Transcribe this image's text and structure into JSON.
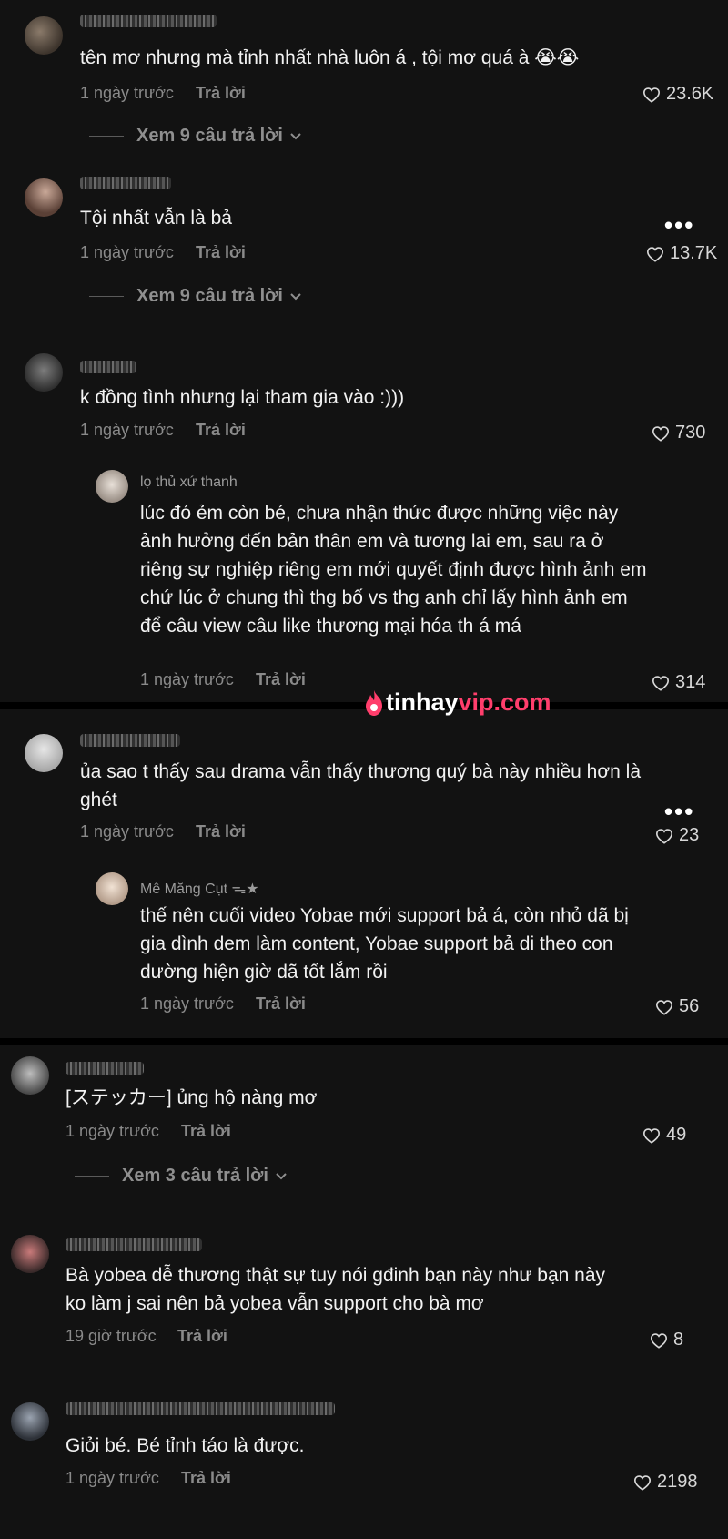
{
  "comments": [
    {
      "text": "tên mơ nhưng mà tỉnh nhất nhà luôn á , tội mơ quá à 😭😭",
      "time": "1 ngày trước",
      "reply": "Trả lời",
      "likes": "23.6K",
      "view_replies": "Xem 9 câu trả lời"
    },
    {
      "text": "Tội nhất vẫn là bả",
      "time": "1 ngày trước",
      "reply": "Trả lời",
      "likes": "13.7K",
      "more": "•••",
      "view_replies": "Xem 9 câu trả lời"
    },
    {
      "text": "k đồng tình nhưng lại tham gia vào :)))",
      "time": "1 ngày trước",
      "reply": "Trả lời",
      "likes": "730",
      "sub": {
        "username": "lọ thủ xứ thanh",
        "text": "lúc đó ẻm còn bé, chưa nhận thức được những việc này ảnh hưởng đến bản thân em và tương lai em, sau ra ở riêng sự nghiệp riêng em mới quyết định được hình ảnh em chứ lúc ở chung thì thg bố vs thg anh chỉ lấy hình ảnh em để câu view câu like thương mại hóa th á má",
        "time": "1 ngày trước",
        "reply": "Trả lời",
        "likes": "314"
      }
    },
    {
      "text": "ủa sao t thấy sau drama vẫn thấy thương quý bà này nhiều hơn là ghét",
      "time": "1 ngày trước",
      "reply": "Trả lời",
      "likes": "23",
      "more": "•••",
      "sub": {
        "username": "Mê Măng Cụt ᯓ★",
        "text": "thế nên cuối video Yobae mới support bả á, còn nhỏ dã bị gia dình dem làm content, Yobae support bả di theo con dường hiện giờ dã tốt lắm rồi",
        "time": "1 ngày trước",
        "reply": "Trả lời",
        "likes": "56"
      }
    },
    {
      "text": "[ステッカー] ủng hộ nàng mơ",
      "time": "1 ngày trước",
      "reply": "Trả lời",
      "likes": "49",
      "view_replies": "Xem 3 câu trả lời"
    },
    {
      "text": "Bà yobea dễ thương thật sự tuy nói gđinh bạn này như bạn này ko làm j sai nên bả yobea vẫn support cho bà mơ",
      "time": "19 giờ trước",
      "reply": "Trả lời",
      "likes": "8"
    },
    {
      "text": "Giỏi bé. Bé tỉnh táo là được.",
      "time": "1 ngày trước",
      "reply": "Trả lời",
      "likes": "2198"
    }
  ],
  "watermark": {
    "part1": "tinhay",
    "part2": "vip.com"
  },
  "colors": {
    "bg": "#121212",
    "brand": "#ff3e6c",
    "muted": "#8a8a8a"
  }
}
